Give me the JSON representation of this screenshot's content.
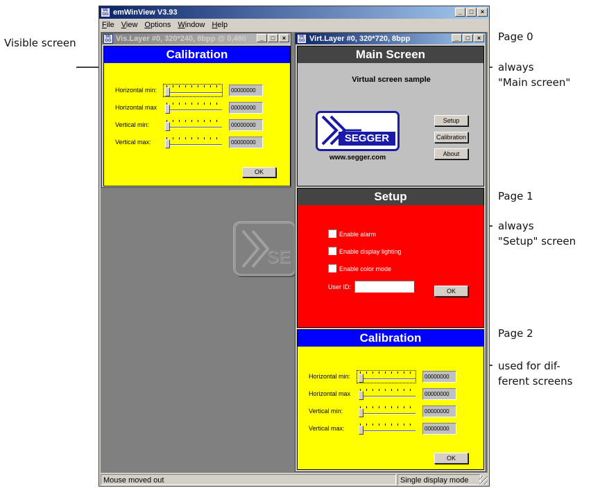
{
  "annotations": {
    "visible_screen": "Visible screen",
    "page0": "Page 0",
    "page1": "Page 1",
    "page2": "Page 2",
    "main_line1": "always",
    "main_line2": "\"Main screen\"",
    "setup_line1": "always",
    "setup_line2": "\"Setup\" screen",
    "calib_line1": "used for dif-",
    "calib_line2": "ferent screens"
  },
  "app": {
    "title": "emWinView V3.93",
    "menu": [
      "File",
      "View",
      "Options",
      "Window",
      "Help"
    ],
    "status_left": "Mouse moved out",
    "status_right": "Single display mode"
  },
  "vis_window": {
    "title": "Vis.Layer #0, 320*240, 8bpp @ 0,480",
    "header": "Calibration",
    "rows": [
      {
        "label": "Horizontal min:",
        "value": "00000000"
      },
      {
        "label": "Horizontal max",
        "value": "00000000"
      },
      {
        "label": "Vertical   min:",
        "value": "00000000"
      },
      {
        "label": "Vertical   max:",
        "value": "00000000"
      }
    ],
    "ok": "OK"
  },
  "virt_window": {
    "title": "Virt.Layer #0, 320*720, 8bpp",
    "main": {
      "header": "Main Screen",
      "subtitle": "Virtual screen sample",
      "logo_text": "SEGGER",
      "url": "www.segger.com",
      "buttons": [
        "Setup",
        "Calibration",
        "About"
      ]
    },
    "setup": {
      "header": "Setup",
      "checks": [
        "Enable alarm",
        "Enable display lighting",
        "Enable color mode"
      ],
      "userid_label": "User ID:",
      "userid_value": "",
      "ok": "OK"
    },
    "calibration": {
      "header": "Calibration",
      "rows": [
        {
          "label": "Horizontal min:",
          "value": "00000000"
        },
        {
          "label": "Horizontal max",
          "value": "00000000"
        },
        {
          "label": "Vertical   min:",
          "value": "00000000"
        },
        {
          "label": "Vertical   max:",
          "value": "00000000"
        }
      ],
      "ok": "OK"
    }
  },
  "background_logo": "SE",
  "colors": {
    "header_blue": "#0000ff",
    "header_gray": "#444444",
    "calibration_bg": "#ffff00",
    "main_bg": "#c0c0c0",
    "setup_bg": "#ff0000"
  }
}
